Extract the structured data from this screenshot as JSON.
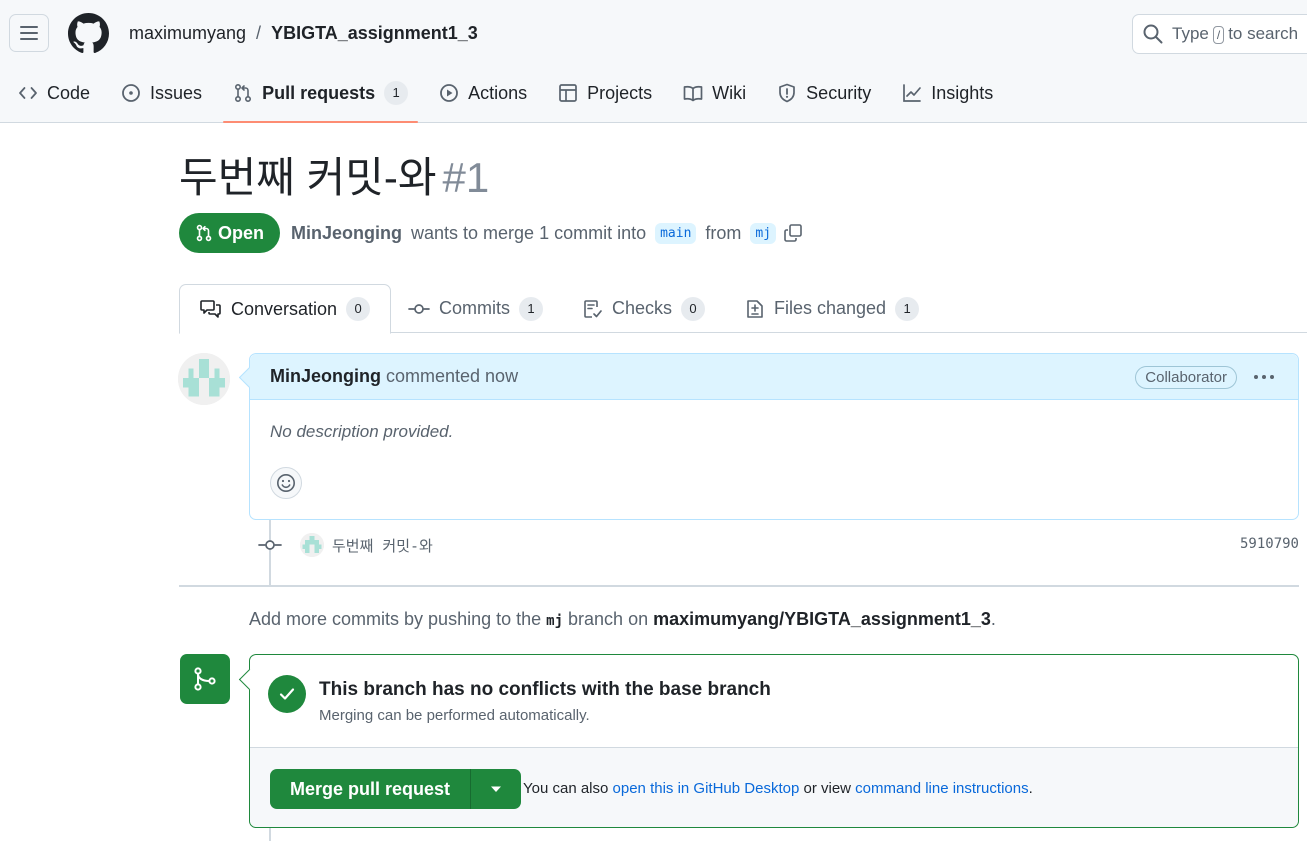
{
  "header": {
    "owner": "maximumyang",
    "separator": "/",
    "repo": "YBIGTA_assignment1_3",
    "search": {
      "prefix": "Type",
      "key": "/",
      "suffix": "to search"
    }
  },
  "repo_nav": [
    {
      "label": "Code",
      "icon": "code-icon"
    },
    {
      "label": "Issues",
      "icon": "issue-icon"
    },
    {
      "label": "Pull requests",
      "icon": "pull-request-icon",
      "count": "1",
      "selected": true
    },
    {
      "label": "Actions",
      "icon": "play-icon"
    },
    {
      "label": "Projects",
      "icon": "table-icon"
    },
    {
      "label": "Wiki",
      "icon": "book-icon"
    },
    {
      "label": "Security",
      "icon": "shield-icon"
    },
    {
      "label": "Insights",
      "icon": "graph-icon"
    }
  ],
  "pr": {
    "title": "두번째 커밋-와",
    "number": "#1",
    "state": "Open",
    "author": "MinJeonging",
    "summary_text": "wants to merge 1 commit into",
    "base_branch": "main",
    "from_text": "from",
    "head_branch": "mj"
  },
  "tabs": [
    {
      "label": "Conversation",
      "count": "0",
      "selected": true
    },
    {
      "label": "Commits",
      "count": "1"
    },
    {
      "label": "Checks",
      "count": "0"
    },
    {
      "label": "Files changed",
      "count": "1"
    }
  ],
  "comment": {
    "author": "MinJeonging",
    "meta": "commented now",
    "badge": "Collaborator",
    "body": "No description provided."
  },
  "commit": {
    "message": "두번째 커밋-와",
    "sha": "5910790"
  },
  "push_note": {
    "before": "Add more commits by pushing to the",
    "branch": "mj",
    "middle": "branch on",
    "repo": "maximumyang/YBIGTA_assignment1_3",
    "end": "."
  },
  "merge": {
    "title": "This branch has no conflicts with the base branch",
    "subtitle": "Merging can be performed automatically.",
    "button": "Merge pull request",
    "alt_prefix": "You can also",
    "alt_link1": "open this in GitHub Desktop",
    "alt_middle": "or view",
    "alt_link2": "command line instructions",
    "alt_end": "."
  },
  "colors": {
    "accent_green": "#1f883d",
    "link_blue": "#0969da",
    "selected_underline": "#fd8c73",
    "comment_header_bg": "#ddf4ff"
  }
}
